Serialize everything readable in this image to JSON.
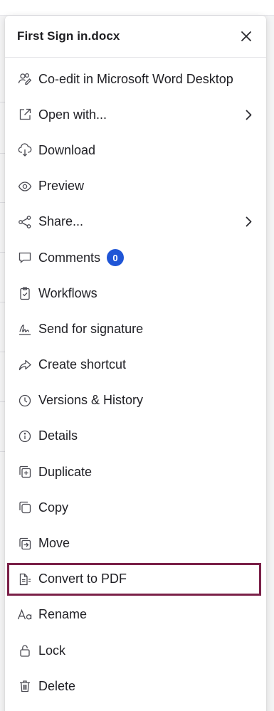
{
  "colors": {
    "accent_badge": "#1f55d6",
    "highlight_border": "#7a2048",
    "text": "#1f1f24",
    "icon": "#4a4a52"
  },
  "panel": {
    "title": "First Sign in.docx",
    "close_icon": "close-icon"
  },
  "menu": [
    {
      "key": "co-edit",
      "label": "Co-edit in Microsoft Word Desktop",
      "icon": "co-edit-icon",
      "submenu": false
    },
    {
      "key": "open-with",
      "label": "Open with...",
      "icon": "open-external-icon",
      "submenu": true
    },
    {
      "key": "download",
      "label": "Download",
      "icon": "cloud-download-icon",
      "submenu": false
    },
    {
      "key": "preview",
      "label": "Preview",
      "icon": "eye-icon",
      "submenu": false
    },
    {
      "key": "share",
      "label": "Share...",
      "icon": "share-icon",
      "submenu": true
    },
    {
      "key": "comments",
      "label": "Comments",
      "icon": "comment-icon",
      "submenu": false,
      "badge": "0"
    },
    {
      "key": "workflows",
      "label": "Workflows",
      "icon": "clipboard-check-icon",
      "submenu": false
    },
    {
      "key": "send-signature",
      "label": "Send for signature",
      "icon": "signature-icon",
      "submenu": false
    },
    {
      "key": "create-shortcut",
      "label": "Create shortcut",
      "icon": "shortcut-arrow-icon",
      "submenu": false
    },
    {
      "key": "versions",
      "label": "Versions & History",
      "icon": "clock-icon",
      "submenu": false
    },
    {
      "key": "details",
      "label": "Details",
      "icon": "info-icon",
      "submenu": false
    },
    {
      "key": "duplicate",
      "label": "Duplicate",
      "icon": "duplicate-icon",
      "submenu": false
    },
    {
      "key": "copy",
      "label": "Copy",
      "icon": "copy-icon",
      "submenu": false
    },
    {
      "key": "move",
      "label": "Move",
      "icon": "move-icon",
      "submenu": false
    },
    {
      "key": "convert-pdf",
      "label": "Convert to PDF",
      "icon": "convert-pdf-icon",
      "submenu": false,
      "highlighted": true
    },
    {
      "key": "rename",
      "label": "Rename",
      "icon": "rename-aa-icon",
      "submenu": false
    },
    {
      "key": "lock",
      "label": "Lock",
      "icon": "lock-icon",
      "submenu": false
    },
    {
      "key": "delete",
      "label": "Delete",
      "icon": "trash-icon",
      "submenu": false
    }
  ]
}
